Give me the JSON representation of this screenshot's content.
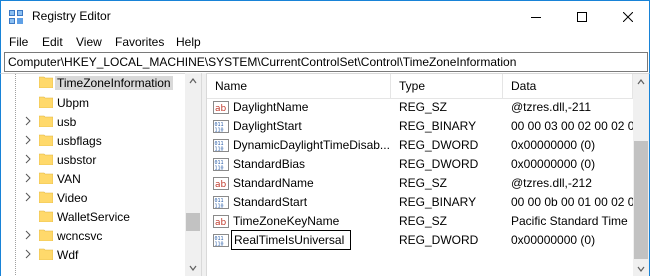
{
  "window": {
    "title": "Registry Editor"
  },
  "menu": {
    "items": [
      {
        "label": "File"
      },
      {
        "label": "Edit"
      },
      {
        "label": "View"
      },
      {
        "label": "Favorites"
      },
      {
        "label": "Help"
      }
    ]
  },
  "address": {
    "path": "Computer\\HKEY_LOCAL_MACHINE\\SYSTEM\\CurrentControlSet\\Control\\TimeZoneInformation"
  },
  "tree": {
    "items": [
      {
        "label": "TimeZoneInformation",
        "expandable": false,
        "selected": true
      },
      {
        "label": "Ubpm",
        "expandable": false
      },
      {
        "label": "usb",
        "expandable": true
      },
      {
        "label": "usbflags",
        "expandable": true
      },
      {
        "label": "usbstor",
        "expandable": true
      },
      {
        "label": "VAN",
        "expandable": true
      },
      {
        "label": "Video",
        "expandable": true
      },
      {
        "label": "WalletService",
        "expandable": false
      },
      {
        "label": "wcncsvc",
        "expandable": true
      },
      {
        "label": "Wdf",
        "expandable": true
      }
    ]
  },
  "values": {
    "columns": {
      "name": "Name",
      "type": "Type",
      "data": "Data"
    },
    "rows": [
      {
        "icon": "string-value-icon",
        "name": "DaylightName",
        "type": "REG_SZ",
        "data": "@tzres.dll,-211"
      },
      {
        "icon": "binary-value-icon",
        "name": "DaylightStart",
        "type": "REG_BINARY",
        "data": "00 00 03 00 02 00 02 0"
      },
      {
        "icon": "binary-value-icon",
        "name": "DynamicDaylightTimeDisab...",
        "type": "REG_DWORD",
        "data": "0x00000000 (0)"
      },
      {
        "icon": "binary-value-icon",
        "name": "StandardBias",
        "type": "REG_DWORD",
        "data": "0x00000000 (0)"
      },
      {
        "icon": "string-value-icon",
        "name": "StandardName",
        "type": "REG_SZ",
        "data": "@tzres.dll,-212"
      },
      {
        "icon": "binary-value-icon",
        "name": "StandardStart",
        "type": "REG_BINARY",
        "data": "00 00 0b 00 01 00 02 0"
      },
      {
        "icon": "string-value-icon",
        "name": "TimeZoneKeyName",
        "type": "REG_SZ",
        "data": "Pacific Standard Time"
      },
      {
        "icon": "binary-value-icon",
        "name": "RealTimeIsUniversal",
        "type": "REG_DWORD",
        "data": "0x00000000 (0)",
        "editing": true
      }
    ]
  },
  "colors": {
    "window_border": "#1883d7",
    "folder": "#ffd96b",
    "selection": "#d9d9d9",
    "string_icon": "#c0392b",
    "binary_icon": "#2b5ea8"
  }
}
